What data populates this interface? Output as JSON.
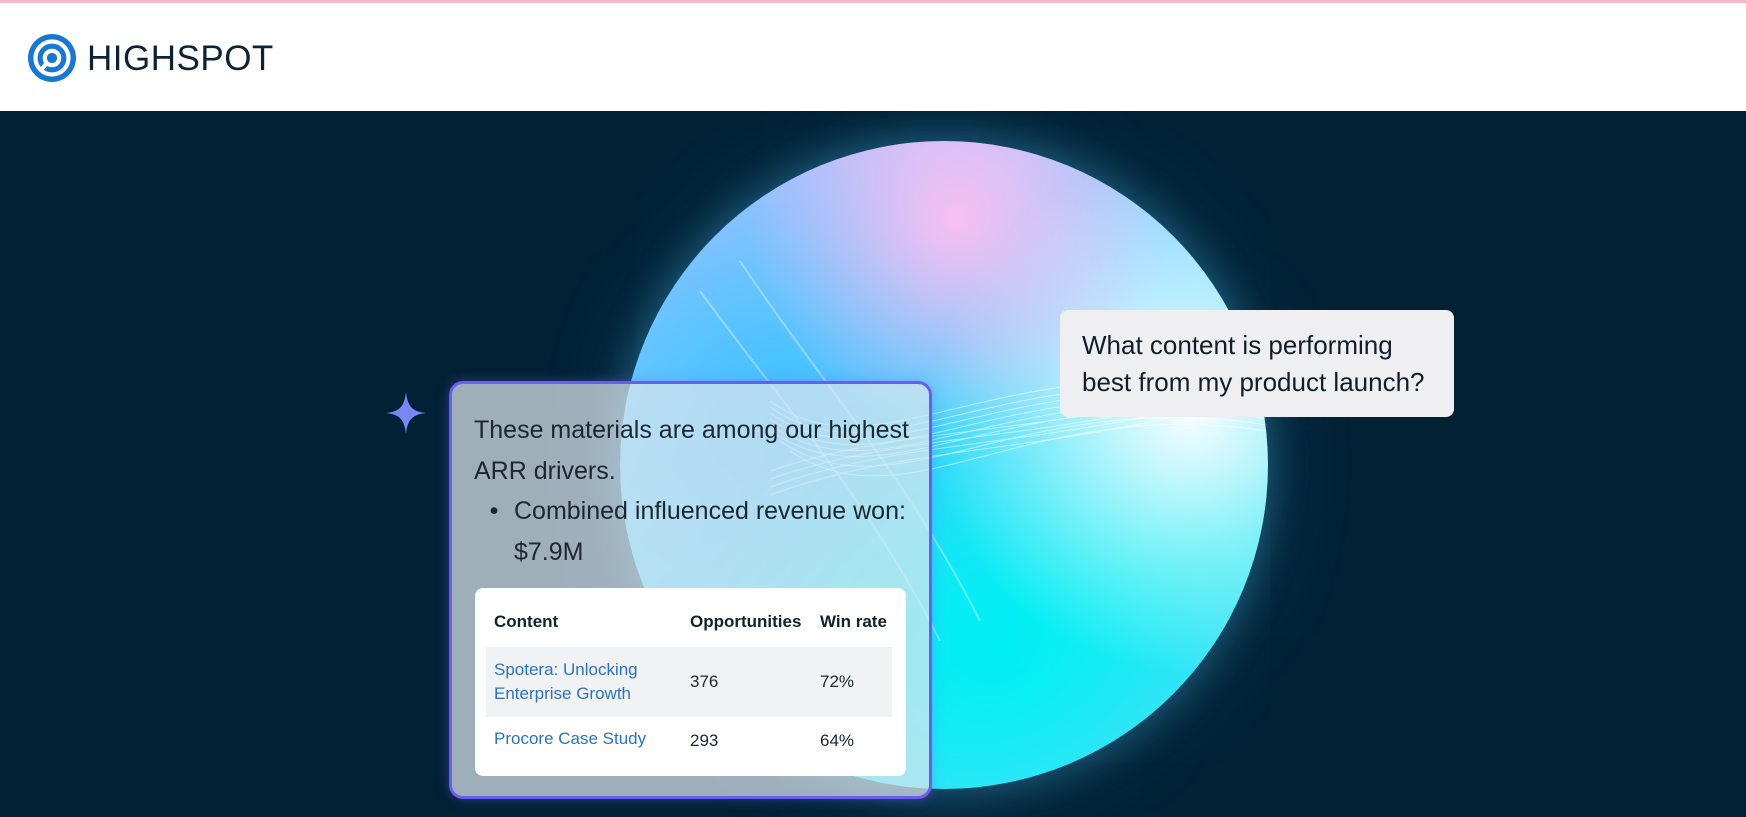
{
  "brand": {
    "name": "HIGHSPOT",
    "logo_icon": "highspot-logo-icon"
  },
  "colors": {
    "top_accent": "#f3b8c8",
    "hero_background": "#022135",
    "card_border": "#6a5ef0",
    "link": "#2d72c2",
    "sparkle": "#7b86f5"
  },
  "hero": {
    "sparkle_icon": "sparkle-icon",
    "question": "What content is performing best from my product launch?",
    "answer": {
      "intro": "These materials are among our highest ARR drivers.",
      "bullets": [
        "Combined influenced revenue won: $7.9M"
      ],
      "table": {
        "headers": [
          "Content",
          "Opportunities",
          "Win rate"
        ],
        "rows": [
          {
            "content": "Spotera: Unlocking Enterprise Growth",
            "opportunities": "376",
            "win_rate": "72%"
          },
          {
            "content": "Procore Case Study",
            "opportunities": "293",
            "win_rate": "64%"
          }
        ]
      }
    }
  }
}
